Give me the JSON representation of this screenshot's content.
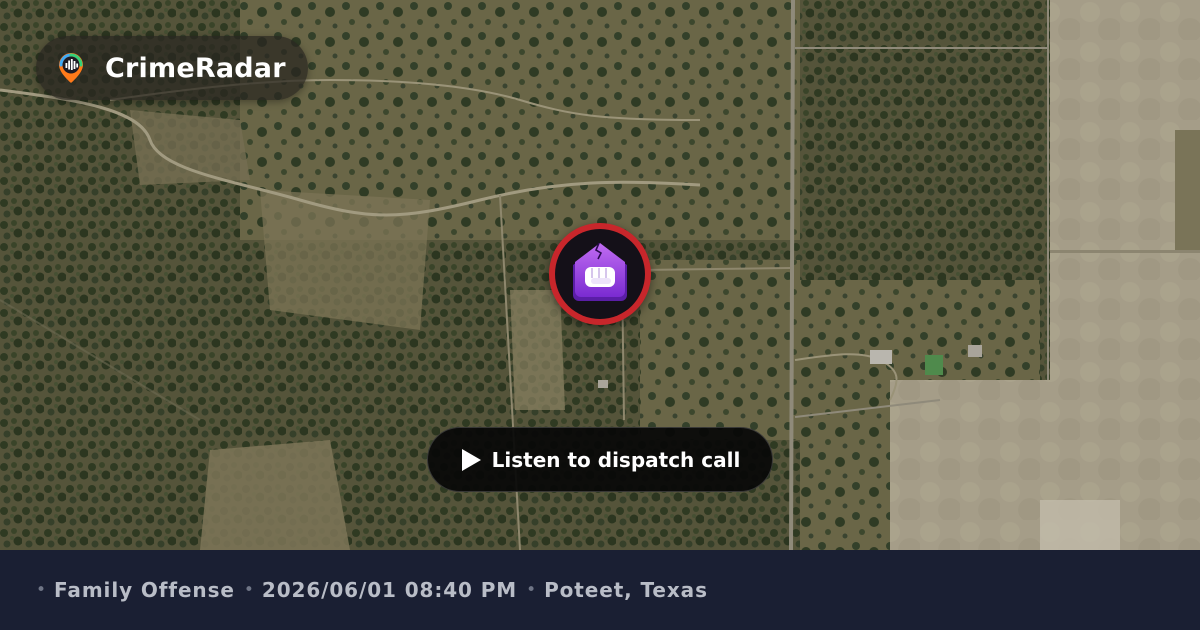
{
  "brand": {
    "name": "CrimeRadar",
    "logo_icon": "crimeradar-pin-logo-icon"
  },
  "map": {
    "type": "satellite",
    "marker_icon": "family-offense-house-fist-icon",
    "marker_ring_color": "#c8262b",
    "marker_tile_color": "#9a3fe0"
  },
  "listen_button": {
    "label": "Listen to dispatch call",
    "icon": "play-icon"
  },
  "footer": {
    "separator": "•",
    "category": "Family Offense",
    "datetime": "2026/06/01 08:40 PM",
    "location": "Poteet, Texas"
  },
  "colors": {
    "footer_bg": "#1a1f33",
    "footer_text": "#b9bdc7",
    "button_bg": "#080808"
  }
}
